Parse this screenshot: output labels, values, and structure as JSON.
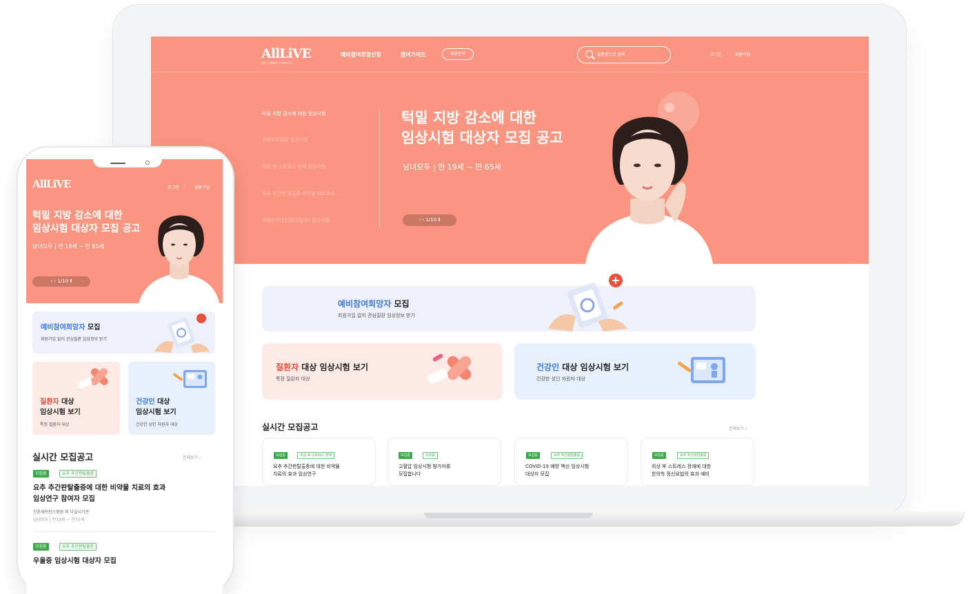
{
  "brand": {
    "logo": "AllLiVE",
    "tagline": "WE CONNECT HEALTH"
  },
  "nav": {
    "items": [
      "예비참여희망신청",
      "참여가이드"
    ],
    "pill": "제휴문의",
    "login": "로그인",
    "signup": "회원가입"
  },
  "search": {
    "placeholder": "질환명으로 검색"
  },
  "hero": {
    "side_items": [
      "턱밑 지방 감소에 대한 임상시험",
      "신체처우질환 임상시험",
      "외상 후 스트레스 장애 임상시험",
      "요추 추간판 탈출증 비약물 치료효과...",
      "치매지각과민증(이탈이) 임상시험"
    ],
    "title_line1": "턱밑 지방 감소에 대한",
    "title_line2": "임상시험 대상자 모집 공고",
    "subtitle": "남녀모두 | 만 19세 ~ 만 65세",
    "pager": "‹ › 1/10 Ⅱ"
  },
  "prelim": {
    "title_hl": "예비참여희망자",
    "title_rest": " 모집",
    "subtitle": "회원가입 없이 관심질환 임상정보 받기"
  },
  "patients": {
    "title_hl": "질환자",
    "title_rest": " 대상 임상시험 보기",
    "subtitle": "특정 질환자 대상"
  },
  "healthy": {
    "title_hl": "건강인",
    "title_rest": " 대상 임상시험 보기",
    "subtitle": "건강한 성인 자원자 대상"
  },
  "realtime": {
    "title": "실시간 모집공고",
    "more": "전체보기 ›"
  },
  "announcements": [
    {
      "status": "모집중",
      "tag": "외상 후 스트레스 장애",
      "line1": "요추 추간판탈출증에 대한 비약물",
      "line2": "치료의 효과 임상연구"
    },
    {
      "status": "모집중",
      "tag": "조루증",
      "line1": "고혈압 임상시험 참가자를",
      "line2": "모집합니다"
    },
    {
      "status": "모집중",
      "tag": "요추 추간판탈출증",
      "line1": "COVID-19 예방 백신 임상시험",
      "line2": "대상자 모집"
    },
    {
      "status": "모집중",
      "tag": "요추 추간판탈출증",
      "line1": "외상 후 스트레스 장애에 대한",
      "line2": "한의학 정신요법의 효과 예비"
    }
  ],
  "mobile": {
    "login": "로그인",
    "signup": "회원가입",
    "title_line1": "턱밑 지방 감소에 대한",
    "title_line2": "임상시험 대상자 모집 공고",
    "subtitle": "남녀모두 | 만 19세 ~ 만 65세",
    "pager": "‹ › 1/10 Ⅱ",
    "prelim_hl": "예비참여희망자",
    "prelim_rest": " 모집",
    "prelim_sub": "회원가입 없이 관심질환 임상정보 받기",
    "patients_hl": "질환자",
    "patients_rest": " 대상",
    "patients_line2": "임상시험 보기",
    "patients_sub": "특정 질환자 대상",
    "healthy_hl": "건강인",
    "healthy_rest": " 대상",
    "healthy_line2": "임상시험 보기",
    "healthy_sub": "건강한 성인 자원자 대상",
    "realtime_title": "실시간 모집공고",
    "more": "전체보기 ›",
    "items": [
      {
        "status": "모집중",
        "tag": "요추 추간판탈출증",
        "line1": "요추 추간판탈출증에 대한 비약물 치료의 효과",
        "line2": "임상연구 참여자 모집",
        "org": "신촌세브란스병원 외 다실시기관",
        "meta": "남녀모두 | 만19세 ~ 만75세"
      },
      {
        "status": "모집중",
        "tag": "요추 추간판탈출증",
        "line1": "우울증 임상시험 대상자 모집"
      }
    ]
  },
  "colors": {
    "hero": "#f99580",
    "accent_red": "#e5513c",
    "accent_blue": "#3d7be0",
    "badge_green": "#3aa84a"
  }
}
